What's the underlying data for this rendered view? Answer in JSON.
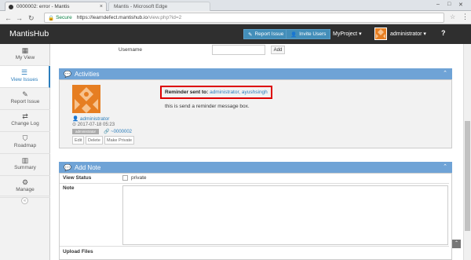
{
  "browser": {
    "tab_title": "0000002: error - Mantis",
    "tab2_title": "Mantis - Microsoft Edge",
    "secure_label": "Secure",
    "url_host": "https://learndefect.mantishub.io",
    "url_path": "/view.php?id=2"
  },
  "header": {
    "brand": "MantisHub",
    "report_issue": "Report Issue",
    "invite_users": "Invite Users",
    "project": "MyProject",
    "username": "administrator",
    "help": "?"
  },
  "sidebar": {
    "items": [
      {
        "label": "My View",
        "icon": "dashboard-icon"
      },
      {
        "label": "View Issues",
        "icon": "list-icon"
      },
      {
        "label": "Report Issue",
        "icon": "edit-icon"
      },
      {
        "label": "Change Log",
        "icon": "retweet-icon"
      },
      {
        "label": "Roadmap",
        "icon": "road-icon"
      },
      {
        "label": "Summary",
        "icon": "bar-chart-icon"
      },
      {
        "label": "Manage",
        "icon": "gears-icon"
      }
    ]
  },
  "monitor": {
    "username_label": "Username",
    "add_button": "Add"
  },
  "activities": {
    "title": "Activities",
    "author": "administrator",
    "date": "2017-07-18 05:23",
    "role": "administrator",
    "note_id": "~0000002",
    "edit": "Edit",
    "delete": "Delete",
    "make_private": "Make Private",
    "reminder_prefix": "Reminder sent to:",
    "reminder_users": "administrator, ayushsingh",
    "message": "this is send a reminder message box."
  },
  "add_note": {
    "title": "Add Note",
    "view_status_label": "View Status",
    "private_label": "private",
    "note_label": "Note",
    "upload_label": "Upload Files"
  },
  "colors": {
    "navbar": "#2f2f2f",
    "panel_header": "#6fa3d6",
    "accent_blue": "#438eb9",
    "highlight_red": "#dd0000",
    "avatar_orange": "#e67e22"
  }
}
